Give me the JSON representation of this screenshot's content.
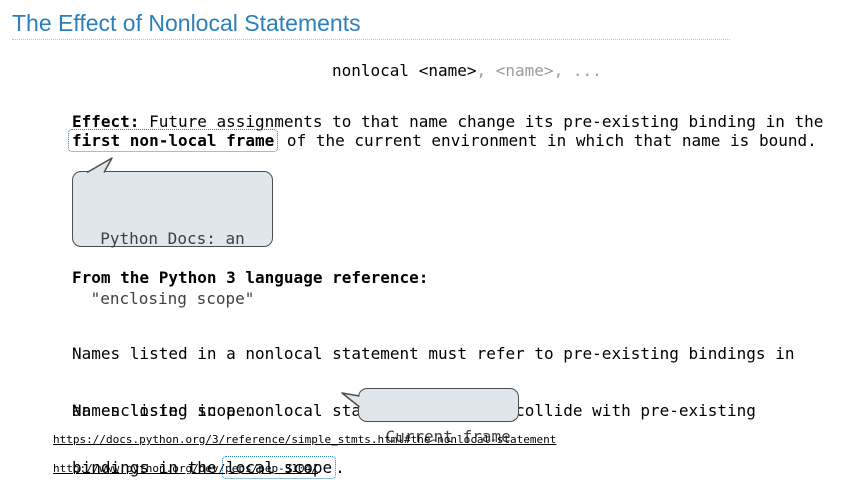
{
  "slide": {
    "title": "The Effect of Nonlocal Statements",
    "syntax": {
      "keyword_part": "nonlocal <name>",
      "rest_part": ", <name>, ..."
    },
    "effect": {
      "label": "Effect:",
      "line1_rest": " Future assignments to that name change its pre-existing binding in the",
      "highlight": "first non-local frame",
      "line2_rest": " of the current environment in which that name is bound."
    },
    "callout_docs": {
      "line1": "Python Docs: an",
      "line2": "\"enclosing scope\""
    },
    "reference": {
      "heading": "From the Python 3 language reference:",
      "para1_line1": "Names listed in a nonlocal statement must refer to pre-existing bindings in",
      "para1_line2": "an enclosing scope.",
      "para2_line1": "Names listed in a nonlocal statement must not collide with pre-existing",
      "para2_line2_prefix": "bindings in the ",
      "para2_highlight": "local scope",
      "para2_line2_suffix": "."
    },
    "callout_frame": {
      "text": "Current frame"
    },
    "links": [
      "https://docs.python.org/3/reference/simple_stmts.html#the-nonlocal-statement",
      "http://www.python.org/dev/peps/pep-3104/"
    ]
  }
}
